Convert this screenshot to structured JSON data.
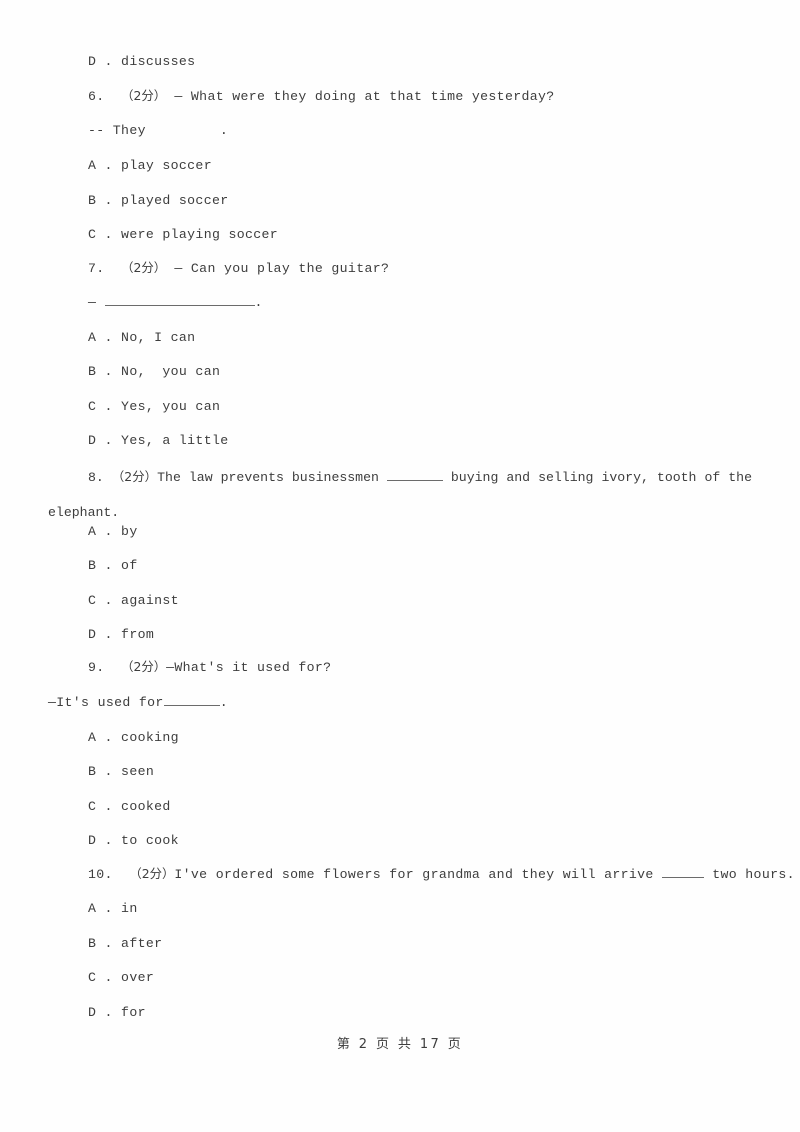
{
  "document": {
    "type": "exam-paper-scan",
    "text_color": "#3d3d3d",
    "background_color": "#ffffff"
  },
  "lines": {
    "prev_option_d": "D . discusses",
    "q6_marks": "（2分）",
    "q6_number": "6.",
    "q6_stem": "— What were they doing at that time yesterday?",
    "q6_answer_prefix": "-- They",
    "q6_answer_suffix": ".",
    "q6_a": "A . play soccer",
    "q6_b": "B . played soccer",
    "q6_c": "C . were playing soccer",
    "q7_number": "7.",
    "q7_marks": "（2分）",
    "q7_stem": "— Can you play the guitar?",
    "q7_answer_prefix": "—",
    "q7_answer_suffix": ".",
    "q7_a": "A . No, I can",
    "q7_b": "B . No,  you can",
    "q7_c": "C . Yes, you can",
    "q7_d": "D . Yes, a little",
    "q8_number": "8.",
    "q8_marks": "（2分）",
    "q8_stem_part1": "The law prevents businessmen ",
    "q8_stem_part2": " buying and selling ivory, tooth of the elephant.",
    "q8_a": "A . by",
    "q8_b": "B . of",
    "q8_c": "C . against",
    "q8_d": "D . from",
    "q9_number": "9.",
    "q9_marks": "（2分）",
    "q9_stem": "—What's it used for?",
    "q9_answer_prefix": "—It's used for",
    "q9_answer_suffix": ".",
    "q9_a": "A . cooking",
    "q9_b": "B . seen",
    "q9_c": "C . cooked",
    "q9_d": "D . to cook",
    "q10_number": "10.",
    "q10_marks": "（2分）",
    "q10_stem_part1": "I've ordered some flowers for grandma and they will arrive ",
    "q10_stem_part2": " two hours.",
    "q10_a": "A . in",
    "q10_b": "B . after",
    "q10_c": "C . over",
    "q10_d": "D . for"
  },
  "footer": {
    "page_label": "第 2 页 共 17 页"
  }
}
